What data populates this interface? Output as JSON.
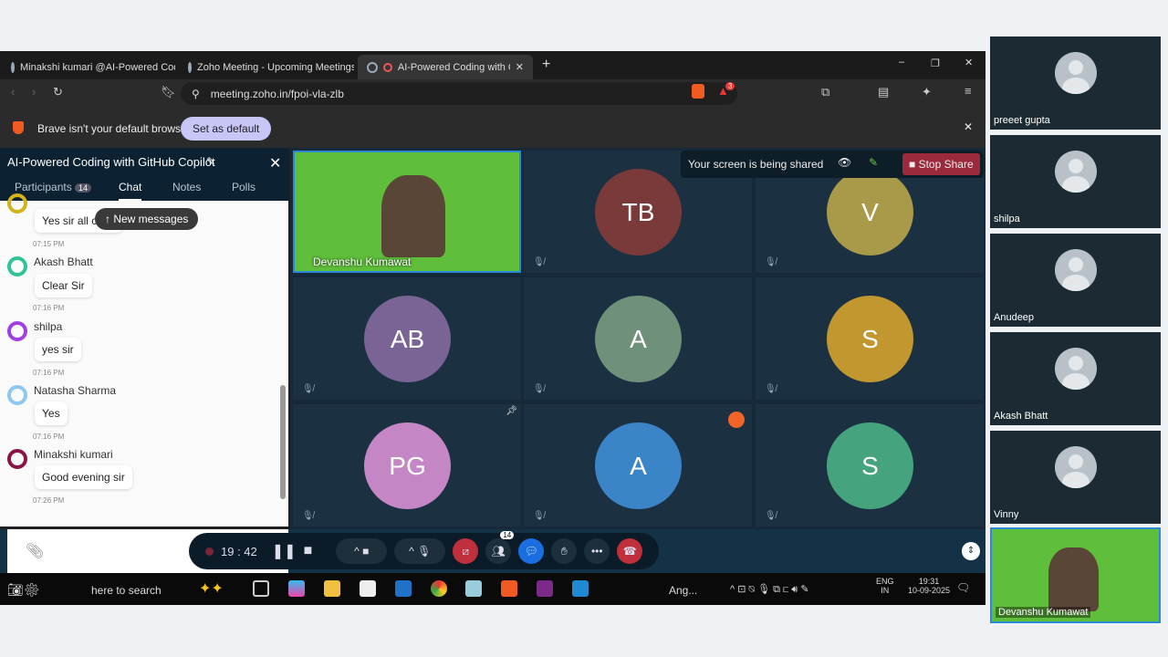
{
  "browser": {
    "tabs": [
      "Minakshi kumari @AI-Powered Codin",
      "Zoho Meeting - Upcoming Meetings",
      "AI-Powered Coding with GitH"
    ],
    "url": "meeting.zoho.in/fpoi-vla-zlb",
    "brave_badge": "3",
    "infobar": {
      "text": "Brave isn't your default browser",
      "button": "Set as default"
    }
  },
  "meeting": {
    "title": "AI-Powered Coding with GitHub Copilot",
    "tabs": {
      "participants": "Participants",
      "count": "14",
      "chat": "Chat",
      "notes": "Notes",
      "polls": "Polls"
    },
    "new_messages": "New messages",
    "messages": [
      {
        "name": "",
        "text": "Yes sir all clear",
        "time": "07:15 PM",
        "color": "#d4b21c"
      },
      {
        "name": "Akash Bhatt",
        "text": "Clear Sir",
        "time": "07:16 PM",
        "color": "#2fc39a"
      },
      {
        "name": "shilpa",
        "text": "yes sir",
        "time": "07:16 PM",
        "color": "#a040e0"
      },
      {
        "name": "Natasha Sharma",
        "text": "Yes",
        "time": "07:16 PM",
        "color": "#8cc8f0"
      },
      {
        "name": "Minakshi kumari",
        "text": "Good evening sir",
        "time": "07:26 PM",
        "color": "#8a1448"
      }
    ],
    "share": {
      "text": "Your screen is being shared",
      "stop": "Stop Share"
    },
    "presenter": "Devanshu Kumawat",
    "tiles": [
      {
        "i": "TB",
        "c": "#7a3a3a"
      },
      {
        "i": "V",
        "c": "#a99a4a"
      },
      {
        "i": "AB",
        "c": "#7a6495"
      },
      {
        "i": "A",
        "c": "#6f9079"
      },
      {
        "i": "S",
        "c": "#c2972f"
      },
      {
        "i": "PG",
        "c": "#c486c4"
      },
      {
        "i": "A",
        "c": "#3c84c8"
      },
      {
        "i": "S",
        "c": "#45a47e"
      }
    ],
    "timer": "19 : 42",
    "participant_badge": "14"
  },
  "taskbar": {
    "search": "here to search",
    "weather": "Ang...",
    "lang1": "ENG",
    "lang2": "IN",
    "time": "19:31",
    "date": "10-09-2025"
  },
  "side": [
    "preeet gupta",
    "shilpa",
    "Anudeep",
    "Akash Bhatt",
    "Vinny",
    "Devanshu Kumawat"
  ]
}
